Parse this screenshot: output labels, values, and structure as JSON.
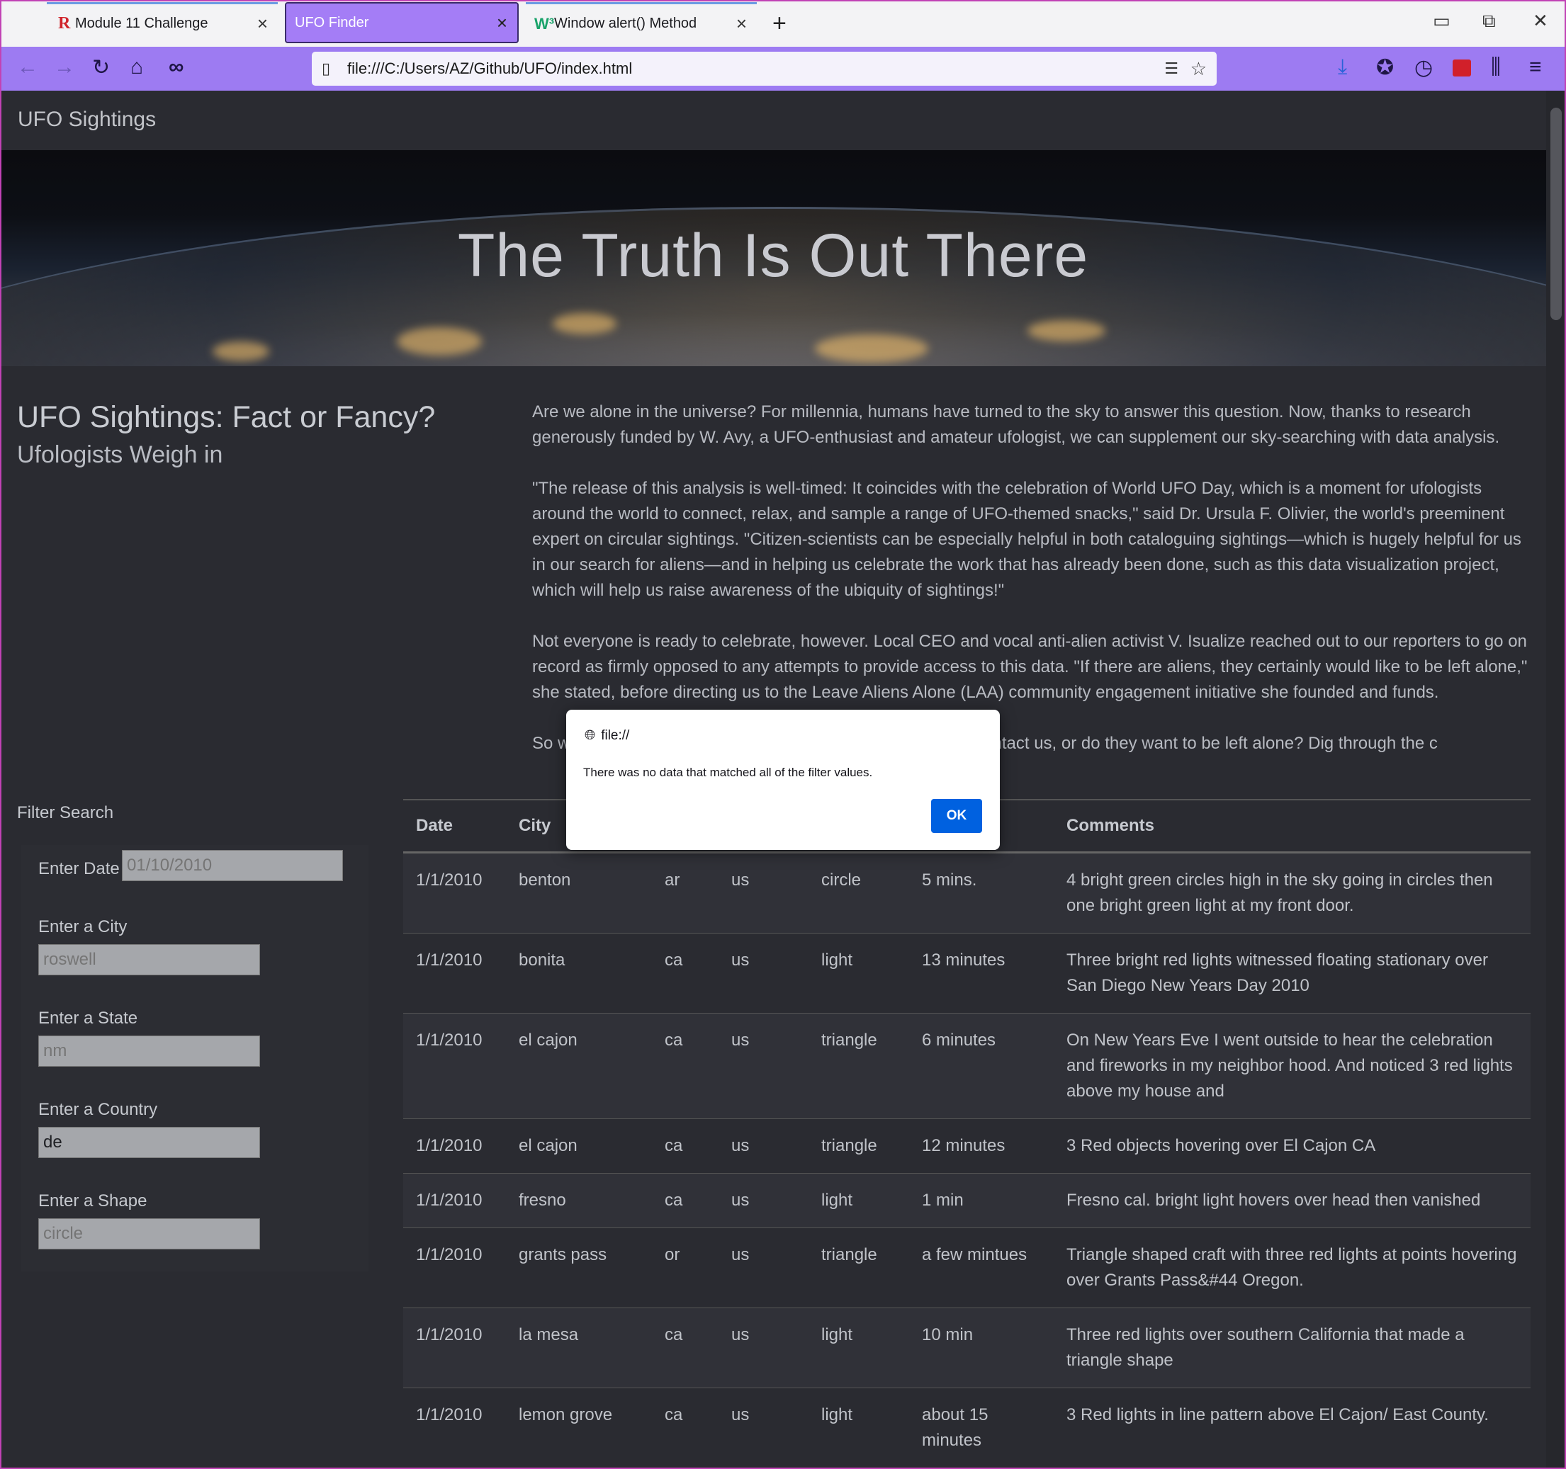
{
  "browser": {
    "tabs": [
      {
        "title": "Module 11 Challenge",
        "favicon": "R"
      },
      {
        "title": "UFO Finder",
        "favicon": ""
      },
      {
        "title": "Window alert() Method",
        "favicon": "W³"
      }
    ],
    "url": "file:///C:/Users/AZ/Github/UFO/index.html",
    "accent_color": "#9d7bf2"
  },
  "page": {
    "brand": "UFO Sightings",
    "hero_title": "The Truth Is Out There",
    "intro_title": "UFO Sightings: Fact or Fancy?",
    "intro_subtitle": "Ufologists Weigh in",
    "article": [
      "Are we alone in the universe? For millennia, humans have turned to the sky to answer this question. Now, thanks to research generously funded by W. Avy, a UFO-enthusiast and amateur ufologist, we can supplement our sky-searching with data analysis.",
      "\"The release of this analysis is well-timed: It coincides with the celebration of World UFO Day, which is a moment for ufologists around the world to connect, relax, and sample a range of UFO-themed snacks,\" said Dr. Ursula F. Olivier, the world's preeminent expert on circular sightings. \"Citizen-scientists can be especially helpful in both cataloguing sightings—which is hugely helpful for us in our search for aliens—and in helping us celebrate the work that has already been done, such as this data visualization project, which will help us raise awareness of the ubiquity of sightings!\"",
      "Not everyone is ready to celebrate, however. Local CEO and vocal anti-alien activist V. Isualize reached out to our reporters to go on record as firmly opposed to any attempts to provide access to this data. \"If there are aliens, they certainly would like to be left alone,\" she stated, before directing us to the Leave Aliens Alone (LAA) community engagement initiative she founded and funds.",
      "So w                                                                     s trying to contact us, or do they want to be left alone? Dig through the c"
    ]
  },
  "filter": {
    "title": "Filter Search",
    "fields": [
      {
        "label": "Enter Date",
        "value": "",
        "placeholder": "01/10/2010"
      },
      {
        "label": "Enter a City",
        "value": "",
        "placeholder": "roswell"
      },
      {
        "label": "Enter a State",
        "value": "",
        "placeholder": "nm"
      },
      {
        "label": "Enter a Country",
        "value": "de",
        "placeholder": ""
      },
      {
        "label": "Enter a Shape",
        "value": "",
        "placeholder": "circle"
      }
    ]
  },
  "table": {
    "headers": [
      "Date",
      "City",
      "",
      "",
      "",
      "",
      "Comments"
    ],
    "rows": [
      [
        "1/1/2010",
        "benton",
        "ar",
        "us",
        "circle",
        "5 mins.",
        "4 bright green circles high in the sky going in circles then one bright green light at my front door."
      ],
      [
        "1/1/2010",
        "bonita",
        "ca",
        "us",
        "light",
        "13 minutes",
        "Three bright red lights witnessed floating stationary over San Diego New Years Day 2010"
      ],
      [
        "1/1/2010",
        "el cajon",
        "ca",
        "us",
        "triangle",
        "6 minutes",
        "On New Years Eve I went outside to hear the celebration and fireworks in my neighbor hood. And noticed 3 red lights above my house and"
      ],
      [
        "1/1/2010",
        "el cajon",
        "ca",
        "us",
        "triangle",
        "12 minutes",
        "3 Red objects hovering over El Cajon CA"
      ],
      [
        "1/1/2010",
        "fresno",
        "ca",
        "us",
        "light",
        "1 min",
        "Fresno cal. bright light hovers over head then vanished"
      ],
      [
        "1/1/2010",
        "grants pass",
        "or",
        "us",
        "triangle",
        "a few mintues",
        "Triangle shaped craft with three red lights at points hovering over Grants Pass&#44 Oregon."
      ],
      [
        "1/1/2010",
        "la mesa",
        "ca",
        "us",
        "light",
        "10 min",
        "Three red lights over southern California that made a triangle shape"
      ],
      [
        "1/1/2010",
        "lemon grove",
        "ca",
        "us",
        "light",
        "about 15 minutes",
        "3 Red lights in line pattern above El Cajon/ East County."
      ]
    ]
  },
  "alert": {
    "origin": "file://",
    "message": "There was no data that matched all of the filter values.",
    "ok_label": "OK"
  }
}
